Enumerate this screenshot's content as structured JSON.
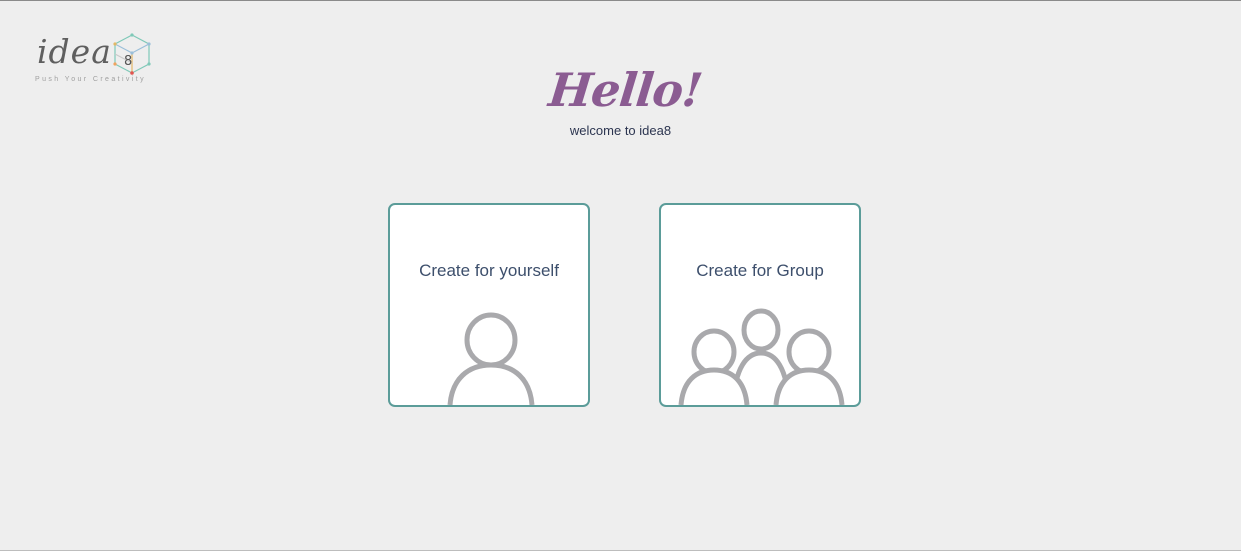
{
  "logo": {
    "wordmark": "idea",
    "tagline": "Push Your Creativity"
  },
  "hero": {
    "title": "Hello!",
    "subtitle": "welcome to idea8"
  },
  "cards": [
    {
      "label": "Create for yourself",
      "icon": "person-icon"
    },
    {
      "label": "Create for Group",
      "icon": "group-icon"
    }
  ],
  "colors": {
    "background": "#eeeeee",
    "title": "#8b5c92",
    "card_border": "#5b9c99",
    "icon_stroke": "#a9a9ac",
    "card_text": "#3d4f6c"
  }
}
